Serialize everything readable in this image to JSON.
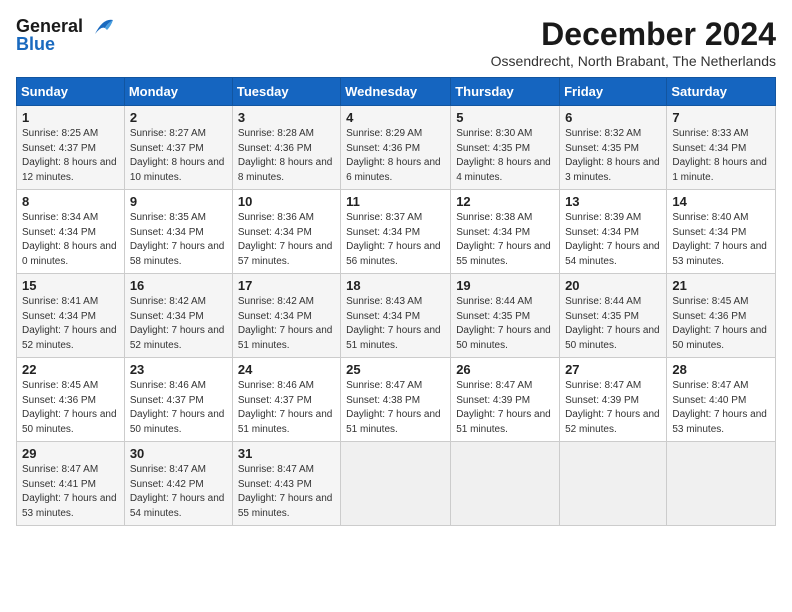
{
  "logo": {
    "line1": "General",
    "line2": "Blue"
  },
  "title": "December 2024",
  "subtitle": "Ossendrecht, North Brabant, The Netherlands",
  "days_of_week": [
    "Sunday",
    "Monday",
    "Tuesday",
    "Wednesday",
    "Thursday",
    "Friday",
    "Saturday"
  ],
  "weeks": [
    [
      {
        "day": "1",
        "sunrise": "Sunrise: 8:25 AM",
        "sunset": "Sunset: 4:37 PM",
        "daylight": "Daylight: 8 hours and 12 minutes."
      },
      {
        "day": "2",
        "sunrise": "Sunrise: 8:27 AM",
        "sunset": "Sunset: 4:37 PM",
        "daylight": "Daylight: 8 hours and 10 minutes."
      },
      {
        "day": "3",
        "sunrise": "Sunrise: 8:28 AM",
        "sunset": "Sunset: 4:36 PM",
        "daylight": "Daylight: 8 hours and 8 minutes."
      },
      {
        "day": "4",
        "sunrise": "Sunrise: 8:29 AM",
        "sunset": "Sunset: 4:36 PM",
        "daylight": "Daylight: 8 hours and 6 minutes."
      },
      {
        "day": "5",
        "sunrise": "Sunrise: 8:30 AM",
        "sunset": "Sunset: 4:35 PM",
        "daylight": "Daylight: 8 hours and 4 minutes."
      },
      {
        "day": "6",
        "sunrise": "Sunrise: 8:32 AM",
        "sunset": "Sunset: 4:35 PM",
        "daylight": "Daylight: 8 hours and 3 minutes."
      },
      {
        "day": "7",
        "sunrise": "Sunrise: 8:33 AM",
        "sunset": "Sunset: 4:34 PM",
        "daylight": "Daylight: 8 hours and 1 minute."
      }
    ],
    [
      {
        "day": "8",
        "sunrise": "Sunrise: 8:34 AM",
        "sunset": "Sunset: 4:34 PM",
        "daylight": "Daylight: 8 hours and 0 minutes."
      },
      {
        "day": "9",
        "sunrise": "Sunrise: 8:35 AM",
        "sunset": "Sunset: 4:34 PM",
        "daylight": "Daylight: 7 hours and 58 minutes."
      },
      {
        "day": "10",
        "sunrise": "Sunrise: 8:36 AM",
        "sunset": "Sunset: 4:34 PM",
        "daylight": "Daylight: 7 hours and 57 minutes."
      },
      {
        "day": "11",
        "sunrise": "Sunrise: 8:37 AM",
        "sunset": "Sunset: 4:34 PM",
        "daylight": "Daylight: 7 hours and 56 minutes."
      },
      {
        "day": "12",
        "sunrise": "Sunrise: 8:38 AM",
        "sunset": "Sunset: 4:34 PM",
        "daylight": "Daylight: 7 hours and 55 minutes."
      },
      {
        "day": "13",
        "sunrise": "Sunrise: 8:39 AM",
        "sunset": "Sunset: 4:34 PM",
        "daylight": "Daylight: 7 hours and 54 minutes."
      },
      {
        "day": "14",
        "sunrise": "Sunrise: 8:40 AM",
        "sunset": "Sunset: 4:34 PM",
        "daylight": "Daylight: 7 hours and 53 minutes."
      }
    ],
    [
      {
        "day": "15",
        "sunrise": "Sunrise: 8:41 AM",
        "sunset": "Sunset: 4:34 PM",
        "daylight": "Daylight: 7 hours and 52 minutes."
      },
      {
        "day": "16",
        "sunrise": "Sunrise: 8:42 AM",
        "sunset": "Sunset: 4:34 PM",
        "daylight": "Daylight: 7 hours and 52 minutes."
      },
      {
        "day": "17",
        "sunrise": "Sunrise: 8:42 AM",
        "sunset": "Sunset: 4:34 PM",
        "daylight": "Daylight: 7 hours and 51 minutes."
      },
      {
        "day": "18",
        "sunrise": "Sunrise: 8:43 AM",
        "sunset": "Sunset: 4:34 PM",
        "daylight": "Daylight: 7 hours and 51 minutes."
      },
      {
        "day": "19",
        "sunrise": "Sunrise: 8:44 AM",
        "sunset": "Sunset: 4:35 PM",
        "daylight": "Daylight: 7 hours and 50 minutes."
      },
      {
        "day": "20",
        "sunrise": "Sunrise: 8:44 AM",
        "sunset": "Sunset: 4:35 PM",
        "daylight": "Daylight: 7 hours and 50 minutes."
      },
      {
        "day": "21",
        "sunrise": "Sunrise: 8:45 AM",
        "sunset": "Sunset: 4:36 PM",
        "daylight": "Daylight: 7 hours and 50 minutes."
      }
    ],
    [
      {
        "day": "22",
        "sunrise": "Sunrise: 8:45 AM",
        "sunset": "Sunset: 4:36 PM",
        "daylight": "Daylight: 7 hours and 50 minutes."
      },
      {
        "day": "23",
        "sunrise": "Sunrise: 8:46 AM",
        "sunset": "Sunset: 4:37 PM",
        "daylight": "Daylight: 7 hours and 50 minutes."
      },
      {
        "day": "24",
        "sunrise": "Sunrise: 8:46 AM",
        "sunset": "Sunset: 4:37 PM",
        "daylight": "Daylight: 7 hours and 51 minutes."
      },
      {
        "day": "25",
        "sunrise": "Sunrise: 8:47 AM",
        "sunset": "Sunset: 4:38 PM",
        "daylight": "Daylight: 7 hours and 51 minutes."
      },
      {
        "day": "26",
        "sunrise": "Sunrise: 8:47 AM",
        "sunset": "Sunset: 4:39 PM",
        "daylight": "Daylight: 7 hours and 51 minutes."
      },
      {
        "day": "27",
        "sunrise": "Sunrise: 8:47 AM",
        "sunset": "Sunset: 4:39 PM",
        "daylight": "Daylight: 7 hours and 52 minutes."
      },
      {
        "day": "28",
        "sunrise": "Sunrise: 8:47 AM",
        "sunset": "Sunset: 4:40 PM",
        "daylight": "Daylight: 7 hours and 53 minutes."
      }
    ],
    [
      {
        "day": "29",
        "sunrise": "Sunrise: 8:47 AM",
        "sunset": "Sunset: 4:41 PM",
        "daylight": "Daylight: 7 hours and 53 minutes."
      },
      {
        "day": "30",
        "sunrise": "Sunrise: 8:47 AM",
        "sunset": "Sunset: 4:42 PM",
        "daylight": "Daylight: 7 hours and 54 minutes."
      },
      {
        "day": "31",
        "sunrise": "Sunrise: 8:47 AM",
        "sunset": "Sunset: 4:43 PM",
        "daylight": "Daylight: 7 hours and 55 minutes."
      },
      null,
      null,
      null,
      null
    ]
  ]
}
